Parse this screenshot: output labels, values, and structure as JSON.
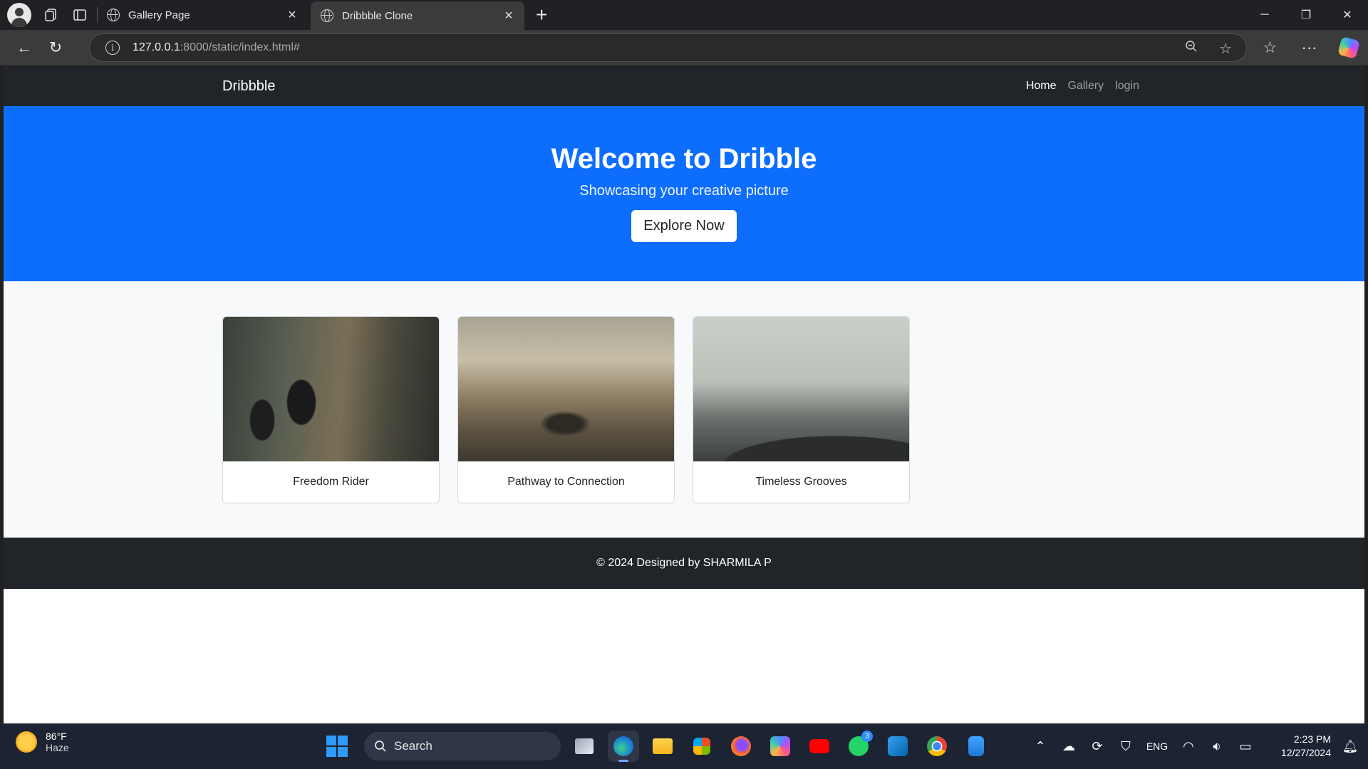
{
  "browser": {
    "tabs": [
      {
        "title": "Gallery Page",
        "active": false
      },
      {
        "title": "Dribbble Clone",
        "active": true
      }
    ],
    "address": {
      "host": "127.0.0.1",
      "rest": ":8000/static/index.html#"
    }
  },
  "site": {
    "brand": "Dribbble",
    "nav": [
      "Home",
      "Gallery",
      "login"
    ],
    "hero": {
      "title": "Welcome to Dribble",
      "subtitle": "Showcasing your creative picture",
      "cta": "Explore Now"
    },
    "cards": [
      {
        "caption": "Freedom Rider"
      },
      {
        "caption": "Pathway to Connection"
      },
      {
        "caption": "Timeless Grooves"
      }
    ],
    "footer": "© 2024 Designed by SHARMILA P"
  },
  "taskbar": {
    "weather": {
      "temp": "86°F",
      "condition": "Haze"
    },
    "search_label": "Search",
    "whatsapp_badge": "3",
    "lang": "ENG",
    "time": "2:23 PM",
    "date": "12/27/2024"
  },
  "colors": {
    "hero_bg": "#0d6efd",
    "nav_bg": "#212529",
    "gallery_bg": "#f8f9fa"
  }
}
